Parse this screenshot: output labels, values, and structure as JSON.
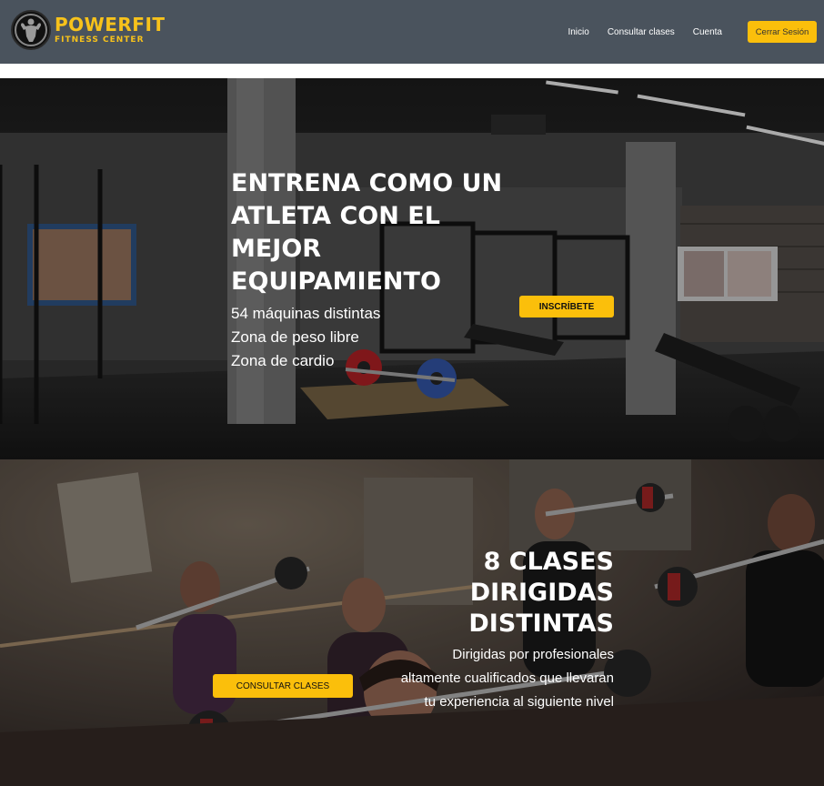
{
  "brand": {
    "name": "POWERFIT",
    "tagline": "FITNESS CENTER",
    "accent_color": "#fbbf0b",
    "logo_icon": "flexing-bodybuilder-icon"
  },
  "nav": {
    "links": [
      "Inicio",
      "Consultar clases",
      "Cuenta"
    ],
    "logout_label": "Cerrar Sesión"
  },
  "hero_equipment": {
    "title": "ENTRENA COMO UN ATLETA CON EL MEJOR EQUIPAMIENTO",
    "features": [
      "54 máquinas distintas",
      "Zona de peso libre",
      "Zona de cardio"
    ],
    "cta_label": "INSCRÍBETE"
  },
  "hero_classes": {
    "title_lines": [
      "8 CLASES",
      "DIRIGIDAS",
      "DISTINTAS"
    ],
    "description": "Dirigidas por profesionales altamente cualificados que llevaran tu experiencia al siguiente nivel",
    "cta_label": "CONSULTAR CLASES"
  }
}
